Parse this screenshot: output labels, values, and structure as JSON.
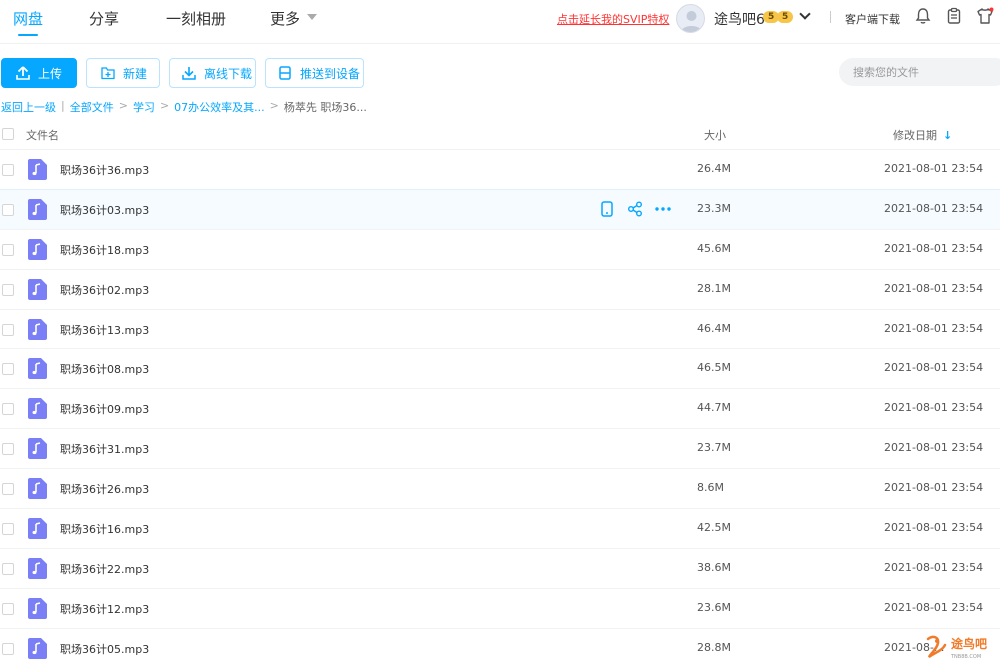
{
  "nav": {
    "tabs": [
      {
        "label": "网盘",
        "active": true
      },
      {
        "label": "分享"
      },
      {
        "label": "一刻相册"
      },
      {
        "label": "更多"
      }
    ],
    "svip_promo": "点击延长我的SVIP特权",
    "username": "途鸟吧6",
    "badges": [
      "5",
      "5"
    ],
    "client_download": "客户端下载",
    "icons": [
      "bell-icon",
      "clipboard-icon",
      "shirt-icon"
    ]
  },
  "toolbar": {
    "upload": "上传",
    "new": "新建",
    "offline_download": "离线下载",
    "push_to_device": "推送到设备",
    "search_placeholder": "搜索您的文件"
  },
  "breadcrumb": {
    "back": "返回上一级",
    "items": [
      "全部文件",
      "学习",
      "07办公效率及其...",
      "杨萃先 职场36..."
    ]
  },
  "list": {
    "headers": {
      "name": "文件名",
      "size": "大小",
      "date": "修改日期",
      "sort_icon": "arrow-down-icon"
    },
    "hover_row_index": 1,
    "files": [
      {
        "name": "职场36计36.mp3",
        "size": "26.4M",
        "date": "2021-08-01 23:54"
      },
      {
        "name": "职场36计03.mp3",
        "size": "23.3M",
        "date": "2021-08-01 23:54"
      },
      {
        "name": "职场36计18.mp3",
        "size": "45.6M",
        "date": "2021-08-01 23:54"
      },
      {
        "name": "职场36计02.mp3",
        "size": "28.1M",
        "date": "2021-08-01 23:54"
      },
      {
        "name": "职场36计13.mp3",
        "size": "46.4M",
        "date": "2021-08-01 23:54"
      },
      {
        "name": "职场36计08.mp3",
        "size": "46.5M",
        "date": "2021-08-01 23:54"
      },
      {
        "name": "职场36计09.mp3",
        "size": "44.7M",
        "date": "2021-08-01 23:54"
      },
      {
        "name": "职场36计31.mp3",
        "size": "23.7M",
        "date": "2021-08-01 23:54"
      },
      {
        "name": "职场36计26.mp3",
        "size": "8.6M",
        "date": "2021-08-01 23:54"
      },
      {
        "name": "职场36计16.mp3",
        "size": "42.5M",
        "date": "2021-08-01 23:54"
      },
      {
        "name": "职场36计22.mp3",
        "size": "38.6M",
        "date": "2021-08-01 23:54"
      },
      {
        "name": "职场36计12.mp3",
        "size": "23.6M",
        "date": "2021-08-01 23:54"
      },
      {
        "name": "职场36计05.mp3",
        "size": "28.8M",
        "date": "2021-08-..."
      }
    ]
  },
  "watermark": {
    "text": "途鸟吧",
    "sub": "TNB8B.COM"
  },
  "colors": {
    "accent": "#06a7ff",
    "promo": "#ff3333",
    "audio_icon": "#7b7ff5"
  }
}
